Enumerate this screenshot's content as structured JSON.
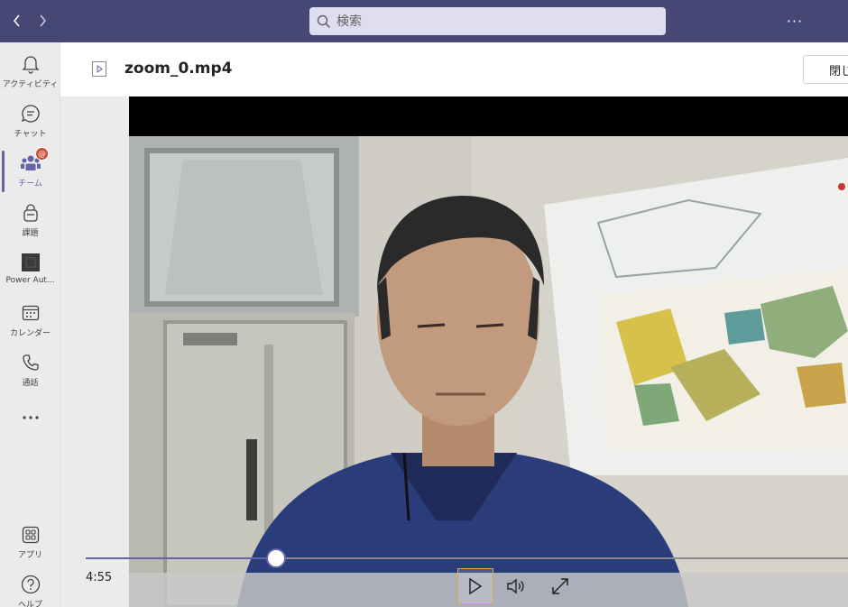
{
  "topbar": {
    "back_icon": "chevron-left-icon",
    "forward_icon": "chevron-right-icon",
    "search_placeholder": "検索",
    "more_label": "···"
  },
  "rail": {
    "items": [
      {
        "label": "アクティビティ",
        "icon": "bell-icon"
      },
      {
        "label": "チャット",
        "icon": "chat-icon"
      },
      {
        "label": "チーム",
        "icon": "teams-icon",
        "active": true,
        "badge": "@"
      },
      {
        "label": "課題",
        "icon": "assignments-icon"
      },
      {
        "label": "Power Aut...",
        "icon": "power-automate-icon"
      },
      {
        "label": "カレンダー",
        "icon": "calendar-icon"
      },
      {
        "label": "通話",
        "icon": "phone-icon"
      },
      {
        "label": "",
        "icon": "more-icon"
      },
      {
        "label": "アプリ",
        "icon": "apps-icon"
      },
      {
        "label": "ヘルプ",
        "icon": "help-icon"
      }
    ]
  },
  "header": {
    "file_name": "zoom_0.mp4",
    "close_label": "閉じる"
  },
  "player": {
    "current_time": "4:55",
    "progress_fraction": 0.25,
    "play_icon": "play-icon",
    "volume_icon": "volume-icon",
    "fullscreen_icon": "fullscreen-icon"
  },
  "colors": {
    "topbar": "#464775",
    "accent": "#6264a7",
    "badge": "#cc4a31"
  }
}
